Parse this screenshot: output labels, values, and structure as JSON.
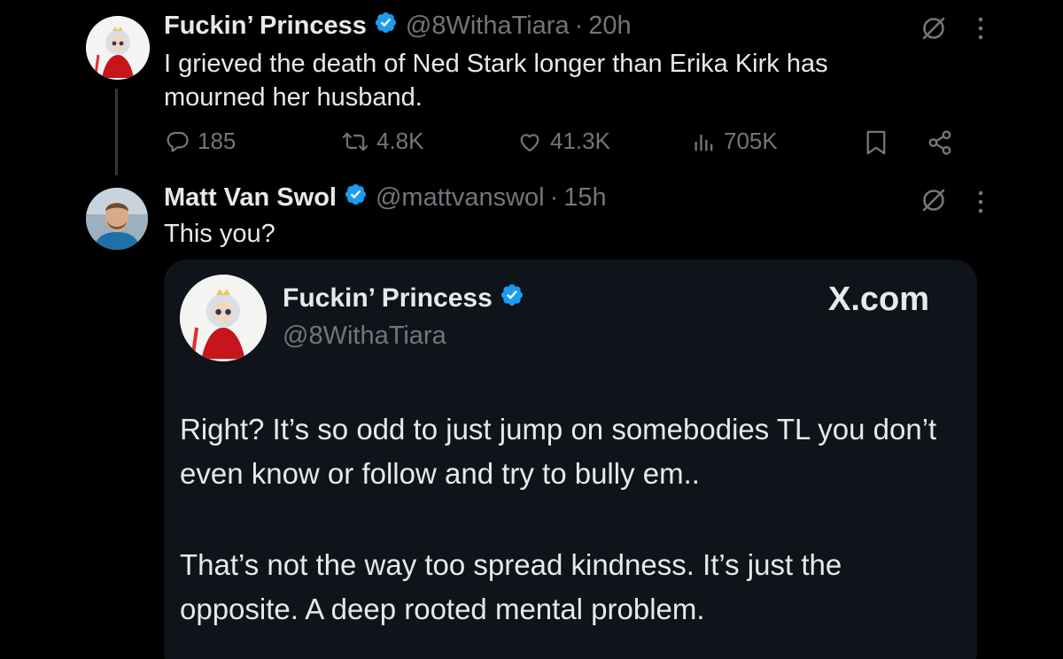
{
  "post1": {
    "name": "Fuckin’ Princess",
    "handle": "@8WithaTiara",
    "separator": "·",
    "time": "20h",
    "text": "I grieved the death of Ned Stark longer than Erika Kirk has mourned her husband.",
    "actions": {
      "replies": "185",
      "reposts": "4.8K",
      "likes": "41.3K",
      "views": "705K"
    }
  },
  "post2": {
    "name": "Matt Van Swol",
    "handle": "@mattvanswol",
    "separator": "·",
    "time": "15h",
    "text": "This you?"
  },
  "quote": {
    "name": "Fuckin’ Princess",
    "handle": "@8WithaTiara",
    "site": "X.com",
    "paragraphs": [
      "Right? It’s so odd to just jump on somebodies TL you don’t even know or follow and try to bully em..",
      "That’s not the way too spread kindness. It’s just the opposite. A deep rooted mental problem."
    ]
  },
  "colors": {
    "background": "#000000",
    "text": "#e7e9ea",
    "muted": "#71767b",
    "verified": "#1d9bf0",
    "card": "#0f141b"
  },
  "icons": [
    "verified-icon",
    "grok-icon",
    "more-icon",
    "reply-icon",
    "repost-icon",
    "like-icon",
    "views-icon",
    "bookmark-icon",
    "share-icon"
  ]
}
